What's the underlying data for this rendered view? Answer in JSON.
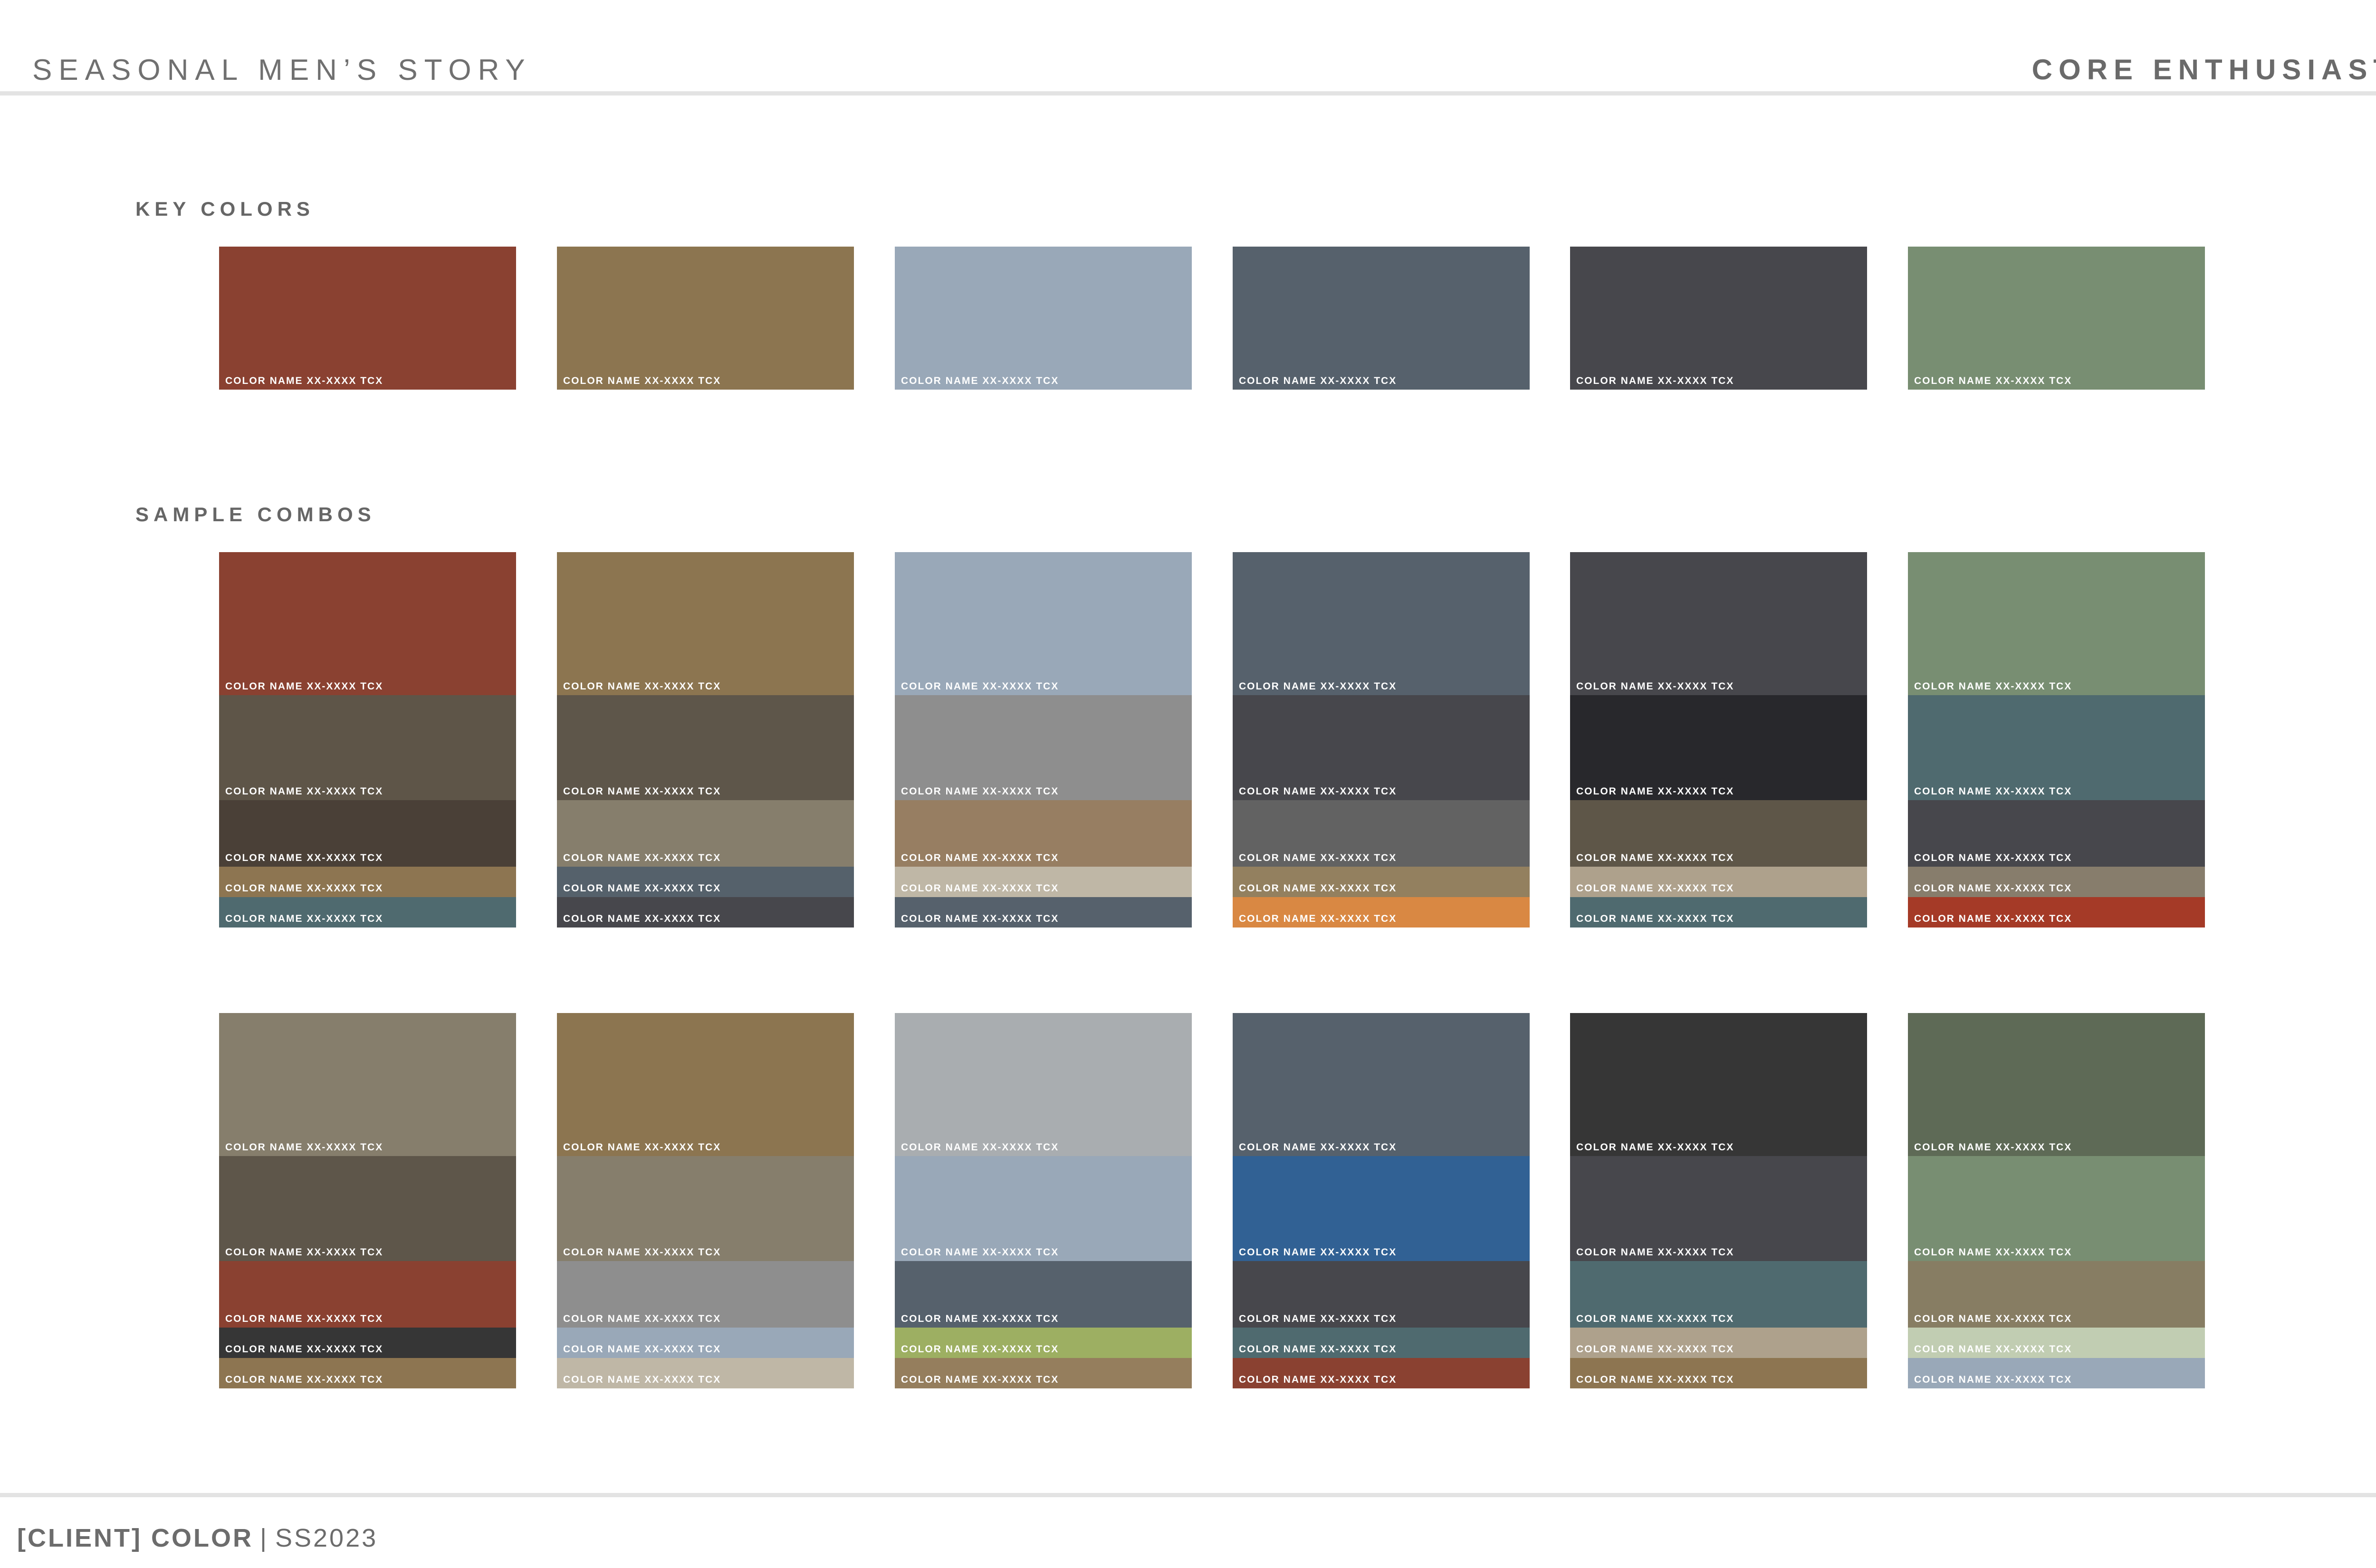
{
  "header": {
    "left_title": "SEASONAL MEN’S STORY",
    "right_title": "CORE ENTHUSIAST"
  },
  "sections": {
    "key_colors_label": "KEY COLORS",
    "sample_combos_label": "SAMPLE COMBOS"
  },
  "key_colors": [
    {
      "label": "COLOR NAME XX-XXXX TCX",
      "color": "#8a4131"
    },
    {
      "label": "COLOR NAME XX-XXXX TCX",
      "color": "#8c7550"
    },
    {
      "label": "COLOR NAME XX-XXXX TCX",
      "color": "#99a8b8"
    },
    {
      "label": "COLOR NAME XX-XXXX TCX",
      "color": "#56616c"
    },
    {
      "label": "COLOR NAME XX-XXXX TCX",
      "color": "#47474c"
    },
    {
      "label": "COLOR NAME XX-XXXX TCX",
      "color": "#788e72"
    }
  ],
  "combos_row_1": [
    {
      "colors": [
        "#8a4131",
        "#5e5548",
        "#4a4037",
        "#8d7551",
        "#4f6a6f"
      ],
      "labels": [
        "COLOR NAME XX-XXXX TCX",
        "COLOR NAME XX-XXXX TCX",
        "COLOR NAME XX-XXXX TCX",
        "COLOR NAME XX-XXXX TCX",
        "COLOR NAME XX-XXXX TCX"
      ]
    },
    {
      "colors": [
        "#8c7550",
        "#5e564a",
        "#867e6c",
        "#55616b",
        "#47474c"
      ],
      "labels": [
        "COLOR NAME XX-XXXX TCX",
        "COLOR NAME XX-XXXX TCX",
        "COLOR NAME XX-XXXX TCX",
        "COLOR NAME XX-XXXX TCX",
        "COLOR NAME XX-XXXX TCX"
      ]
    },
    {
      "colors": [
        "#99a8b8",
        "#8e8e8e",
        "#977e62",
        "#bfb7a6",
        "#56616c"
      ],
      "labels": [
        "COLOR NAME XX-XXXX TCX",
        "COLOR NAME XX-XXXX TCX",
        "COLOR NAME XX-XXXX TCX",
        "COLOR NAME XX-XXXX TCX",
        "COLOR NAME XX-XXXX TCX"
      ]
    },
    {
      "colors": [
        "#56616c",
        "#47474c",
        "#626262",
        "#93805f",
        "#d98843"
      ],
      "labels": [
        "COLOR NAME XX-XXXX TCX",
        "COLOR NAME XX-XXXX TCX",
        "COLOR NAME XX-XXXX TCX",
        "COLOR NAME XX-XXXX TCX",
        "COLOR NAME XX-XXXX TCX"
      ]
    },
    {
      "colors": [
        "#47474c",
        "#28282c",
        "#5e5648",
        "#aea18c",
        "#4f6a6f"
      ],
      "labels": [
        "COLOR NAME XX-XXXX TCX",
        "COLOR NAME XX-XXXX TCX",
        "COLOR NAME XX-XXXX TCX",
        "COLOR NAME XX-XXXX TCX",
        "COLOR NAME XX-XXXX TCX"
      ]
    },
    {
      "colors": [
        "#788e72",
        "#4f6a6f",
        "#47474c",
        "#877d6c",
        "#a53a27"
      ],
      "labels": [
        "COLOR NAME XX-XXXX TCX",
        "COLOR NAME XX-XXXX TCX",
        "COLOR NAME XX-XXXX TCX",
        "COLOR NAME XX-XXXX TCX",
        "COLOR NAME XX-XXXX TCX"
      ]
    }
  ],
  "combos_row_2": [
    {
      "colors": [
        "#867e6c",
        "#5e564a",
        "#8a4131",
        "#363636",
        "#8d7551"
      ],
      "labels": [
        "COLOR NAME XX-XXXX TCX",
        "COLOR NAME XX-XXXX TCX",
        "COLOR NAME XX-XXXX TCX",
        "COLOR NAME XX-XXXX TCX",
        "COLOR NAME XX-XXXX TCX"
      ]
    },
    {
      "colors": [
        "#8c7550",
        "#867e6c",
        "#8e8e8e",
        "#99a8b8",
        "#bfb7a6"
      ],
      "labels": [
        "COLOR NAME XX-XXXX TCX",
        "COLOR NAME XX-XXXX TCX",
        "COLOR NAME XX-XXXX TCX",
        "COLOR NAME XX-XXXX TCX",
        "COLOR NAME XX-XXXX TCX"
      ]
    },
    {
      "colors": [
        "#a9adb0",
        "#99a8b8",
        "#56616c",
        "#9daf62",
        "#957e5d"
      ],
      "labels": [
        "COLOR NAME XX-XXXX TCX",
        "COLOR NAME XX-XXXX TCX",
        "COLOR NAME XX-XXXX TCX",
        "COLOR NAME XX-XXXX TCX",
        "COLOR NAME XX-XXXX TCX"
      ]
    },
    {
      "colors": [
        "#56616c",
        "#316194",
        "#47474c",
        "#4f6a6f",
        "#8a4131"
      ],
      "labels": [
        "COLOR NAME XX-XXXX TCX",
        "COLOR NAME XX-XXXX TCX",
        "COLOR NAME XX-XXXX TCX",
        "COLOR NAME XX-XXXX TCX",
        "COLOR NAME XX-XXXX TCX"
      ]
    },
    {
      "colors": [
        "#363636",
        "#47474c",
        "#4f6a6f",
        "#aea18c",
        "#8d7551"
      ],
      "labels": [
        "COLOR NAME XX-XXXX TCX",
        "COLOR NAME XX-XXXX TCX",
        "COLOR NAME XX-XXXX TCX",
        "COLOR NAME XX-XXXX TCX",
        "COLOR NAME XX-XXXX TCX"
      ]
    },
    {
      "colors": [
        "#5e6a56",
        "#788e72",
        "#877d63",
        "#c1cdb2",
        "#99a8b8"
      ],
      "labels": [
        "COLOR NAME XX-XXXX TCX",
        "COLOR NAME XX-XXXX TCX",
        "COLOR NAME XX-XXXX TCX",
        "COLOR NAME XX-XXXX TCX",
        "COLOR NAME XX-XXXX TCX"
      ]
    }
  ],
  "footer": {
    "client": "[CLIENT] COLOR",
    "separator": "|",
    "season": "SS2023"
  }
}
